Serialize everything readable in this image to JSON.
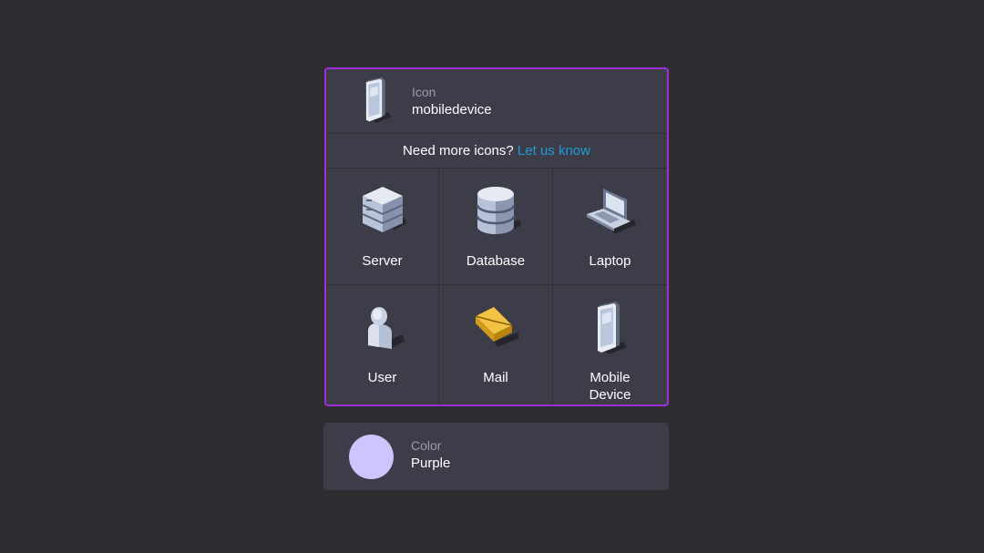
{
  "icon_field": {
    "label": "Icon",
    "value": "mobiledevice",
    "icon": "mobile-device-icon"
  },
  "notice": {
    "text": "Need more icons?",
    "link": "Let us know",
    "link_color": "#1e9bd7"
  },
  "icons": [
    {
      "label": "Server",
      "icon": "server-icon"
    },
    {
      "label": "Database",
      "icon": "database-icon"
    },
    {
      "label": "Laptop",
      "icon": "laptop-icon"
    },
    {
      "label": "User",
      "icon": "user-icon"
    },
    {
      "label": "Mail",
      "icon": "mail-icon"
    },
    {
      "label": "Mobile\nDevice",
      "icon": "mobile-device-icon"
    }
  ],
  "color_field": {
    "label": "Color",
    "value": "Purple",
    "swatch": "#cfc4ff"
  },
  "colors": {
    "selection_border": "#9b30d9",
    "panel_bg": "#3d3d4a",
    "page_bg": "#2d2d32"
  }
}
